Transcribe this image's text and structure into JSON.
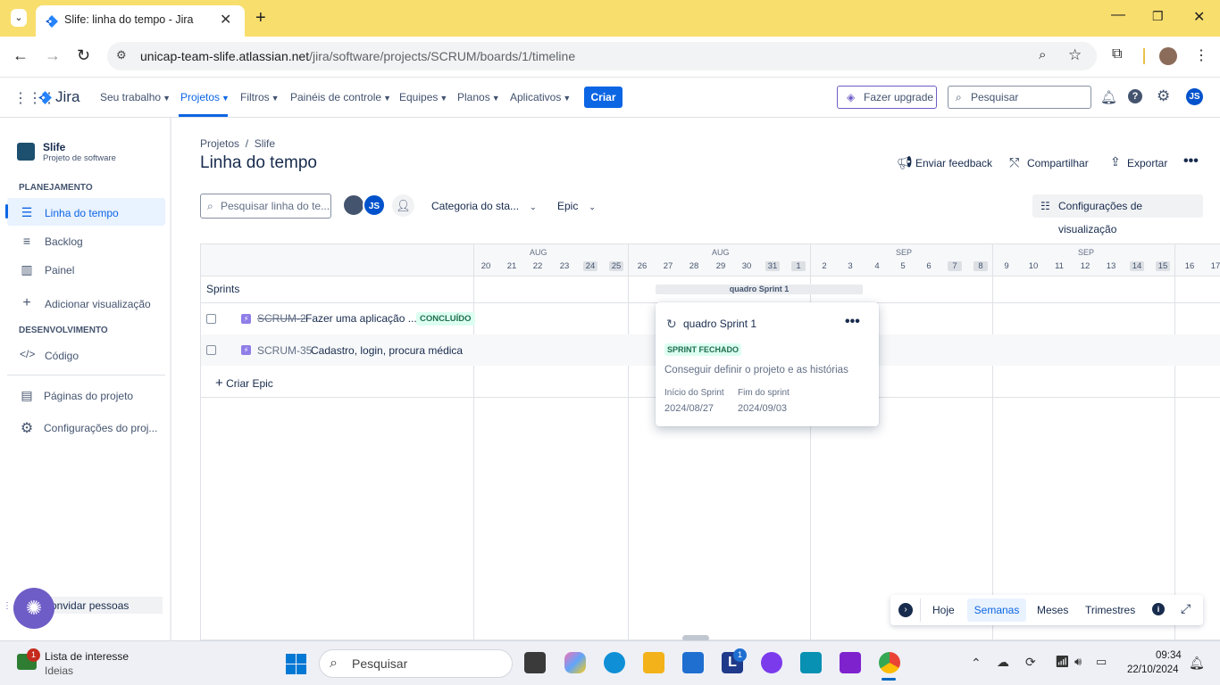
{
  "browser": {
    "tab_title": "Slife: linha do tempo - Jira",
    "url_host": "unicap-team-slife.atlassian.net",
    "url_path": "/jira/software/projects/SCRUM/boards/1/timeline"
  },
  "jira_nav": {
    "logo": "Jira",
    "items": [
      "Seu trabalho",
      "Projetos",
      "Filtros",
      "Painéis de controle",
      "Equipes",
      "Planos",
      "Aplicativos"
    ],
    "create": "Criar",
    "upgrade": "Fazer upgrade",
    "search_placeholder": "Pesquisar",
    "avatar": "JS"
  },
  "sidebar": {
    "project_name": "Slife",
    "project_type": "Projeto de software",
    "planning_header": "PLANEJAMENTO",
    "planning_items": [
      "Linha do tempo",
      "Backlog",
      "Painel"
    ],
    "add_view": "Adicionar visualização",
    "dev_header": "DESENVOLVIMENTO",
    "code": "Código",
    "pages": "Páginas do projeto",
    "settings": "Configurações do proj...",
    "invite": "onvidar pessoas"
  },
  "page": {
    "breadcrumb_1": "Projetos",
    "breadcrumb_sep": "/",
    "breadcrumb_2": "Slife",
    "title": "Linha do tempo",
    "feedback": "Enviar feedback",
    "share": "Compartilhar",
    "export": "Exportar",
    "search_placeholder": "Pesquisar linha do te...",
    "status_filter": "Categoria do sta...",
    "epic_filter": "Epic",
    "view_settings": "Configurações de visualização",
    "avatar_initials": "JS"
  },
  "timeline": {
    "months": [
      "AUG",
      "AUG",
      "SEP",
      "SEP"
    ],
    "days": [
      "20",
      "21",
      "22",
      "23",
      "24",
      "25",
      "26",
      "27",
      "28",
      "29",
      "30",
      "31",
      "1",
      "2",
      "3",
      "4",
      "5",
      "6",
      "7",
      "8",
      "9",
      "10",
      "11",
      "12",
      "13",
      "14",
      "15",
      "16",
      "17"
    ],
    "sprints_label": "Sprints",
    "sprint_bar": "quadro Sprint 1",
    "rows": [
      {
        "key": "SCRUM-2",
        "summary": "Fazer uma aplicação ...",
        "status": "CONCLUÍDO"
      },
      {
        "key": "SCRUM-35",
        "summary": "Cadastro, login, procura médica",
        "status": ""
      }
    ],
    "create_epic": "Criar Epic"
  },
  "popup": {
    "title": "quadro Sprint 1",
    "badge": "SPRINT FECHADO",
    "goal": "Conseguir definir o projeto e as histórias",
    "start_label": "Início do Sprint",
    "start_value": "2024/08/27",
    "end_label": "Fim do sprint",
    "end_value": "2024/09/03"
  },
  "controls": {
    "today": "Hoje",
    "weeks": "Semanas",
    "months": "Meses",
    "quarters": "Trimestres"
  },
  "taskbar": {
    "widget_title": "Lista de interesse",
    "widget_sub": "Ideias",
    "widget_badge": "1",
    "search": "Pesquisar",
    "app_badge": "1",
    "time": "09:34",
    "date": "22/10/2024"
  },
  "colors": {
    "accent": "#0c66e4",
    "tab_bar": "#f8de6d",
    "epic_purple": "#8f7ee7",
    "success_bg": "#dcfff1"
  }
}
